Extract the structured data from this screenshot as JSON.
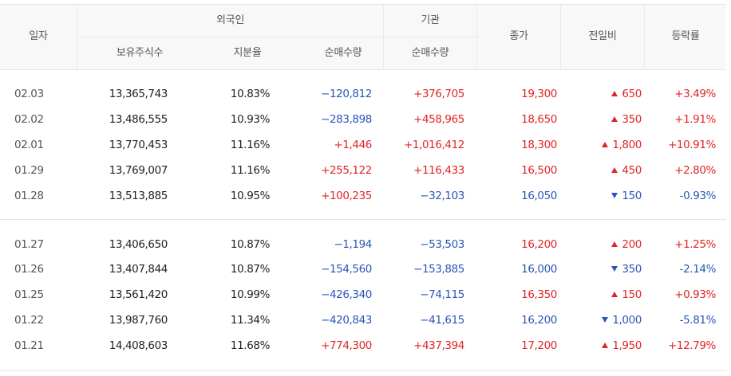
{
  "header": {
    "date": "일자",
    "foreign": "외국인",
    "institution": "기관",
    "close": "종가",
    "change": "전일비",
    "rate": "등락률",
    "holdings": "보유주식수",
    "ratio": "지분율",
    "foreign_net": "순매수량",
    "institution_net": "순매수량"
  },
  "colors": {
    "up": "#e12525",
    "down": "#2a55b8"
  },
  "rows": [
    {
      "date": "02.03",
      "holdings": "13,365,743",
      "ratio": "10.83%",
      "foreign_net": "−120,812",
      "institution_net": "+376,705",
      "close": "19,300",
      "change": "650",
      "change_dir": "up",
      "rate": "+3.49%"
    },
    {
      "date": "02.02",
      "holdings": "13,486,555",
      "ratio": "10.93%",
      "foreign_net": "−283,898",
      "institution_net": "+458,965",
      "close": "18,650",
      "change": "350",
      "change_dir": "up",
      "rate": "+1.91%"
    },
    {
      "date": "02.01",
      "holdings": "13,770,453",
      "ratio": "11.16%",
      "foreign_net": "+1,446",
      "institution_net": "+1,016,412",
      "close": "18,300",
      "change": "1,800",
      "change_dir": "up",
      "rate": "+10.91%"
    },
    {
      "date": "01.29",
      "holdings": "13,769,007",
      "ratio": "11.16%",
      "foreign_net": "+255,122",
      "institution_net": "+116,433",
      "close": "16,500",
      "change": "450",
      "change_dir": "up",
      "rate": "+2.80%"
    },
    {
      "date": "01.28",
      "holdings": "13,513,885",
      "ratio": "10.95%",
      "foreign_net": "+100,235",
      "institution_net": "−32,103",
      "close": "16,050",
      "change": "150",
      "change_dir": "down",
      "rate": "-0.93%"
    },
    {
      "date": "01.27",
      "holdings": "13,406,650",
      "ratio": "10.87%",
      "foreign_net": "−1,194",
      "institution_net": "−53,503",
      "close": "16,200",
      "change": "200",
      "change_dir": "up",
      "rate": "+1.25%"
    },
    {
      "date": "01.26",
      "holdings": "13,407,844",
      "ratio": "10.87%",
      "foreign_net": "−154,560",
      "institution_net": "−153,885",
      "close": "16,000",
      "change": "350",
      "change_dir": "down",
      "rate": "-2.14%"
    },
    {
      "date": "01.25",
      "holdings": "13,561,420",
      "ratio": "10.99%",
      "foreign_net": "−426,340",
      "institution_net": "−74,115",
      "close": "16,350",
      "change": "150",
      "change_dir": "up",
      "rate": "+0.93%"
    },
    {
      "date": "01.22",
      "holdings": "13,987,760",
      "ratio": "11.34%",
      "foreign_net": "−420,843",
      "institution_net": "−41,615",
      "close": "16,200",
      "change": "1,000",
      "change_dir": "down",
      "rate": "-5.81%"
    },
    {
      "date": "01.21",
      "holdings": "14,408,603",
      "ratio": "11.68%",
      "foreign_net": "+774,300",
      "institution_net": "+437,394",
      "close": "17,200",
      "change": "1,950",
      "change_dir": "up",
      "rate": "+12.79%"
    }
  ]
}
